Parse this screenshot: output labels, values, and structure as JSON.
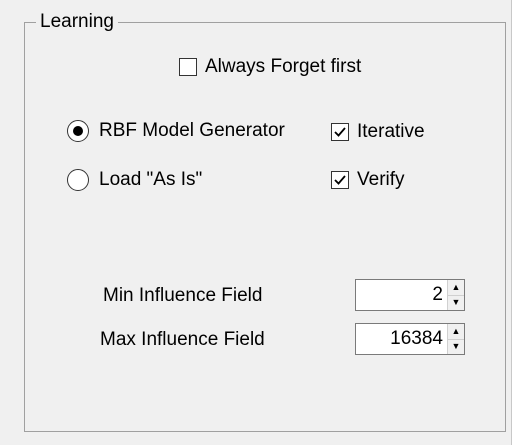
{
  "group": {
    "title": "Learning"
  },
  "always_forget": {
    "label": "Always Forget first",
    "checked": false
  },
  "mode": {
    "options": [
      {
        "label": "RBF Model Generator",
        "selected": true
      },
      {
        "label": "Load \"As Is\"",
        "selected": false
      }
    ]
  },
  "options": {
    "iterative": {
      "label": "Iterative",
      "checked": true
    },
    "verify": {
      "label": "Verify",
      "checked": true
    }
  },
  "min_influence": {
    "label": "Min Influence Field",
    "value": "2"
  },
  "max_influence": {
    "label": "Max Influence Field",
    "value": "16384"
  },
  "icons": {
    "check": "checkmark-icon",
    "spin_up": "spin-up-icon",
    "spin_down": "spin-down-icon"
  },
  "colors": {
    "panel": "#f0f0f0",
    "border": "#a0a0a0"
  }
}
